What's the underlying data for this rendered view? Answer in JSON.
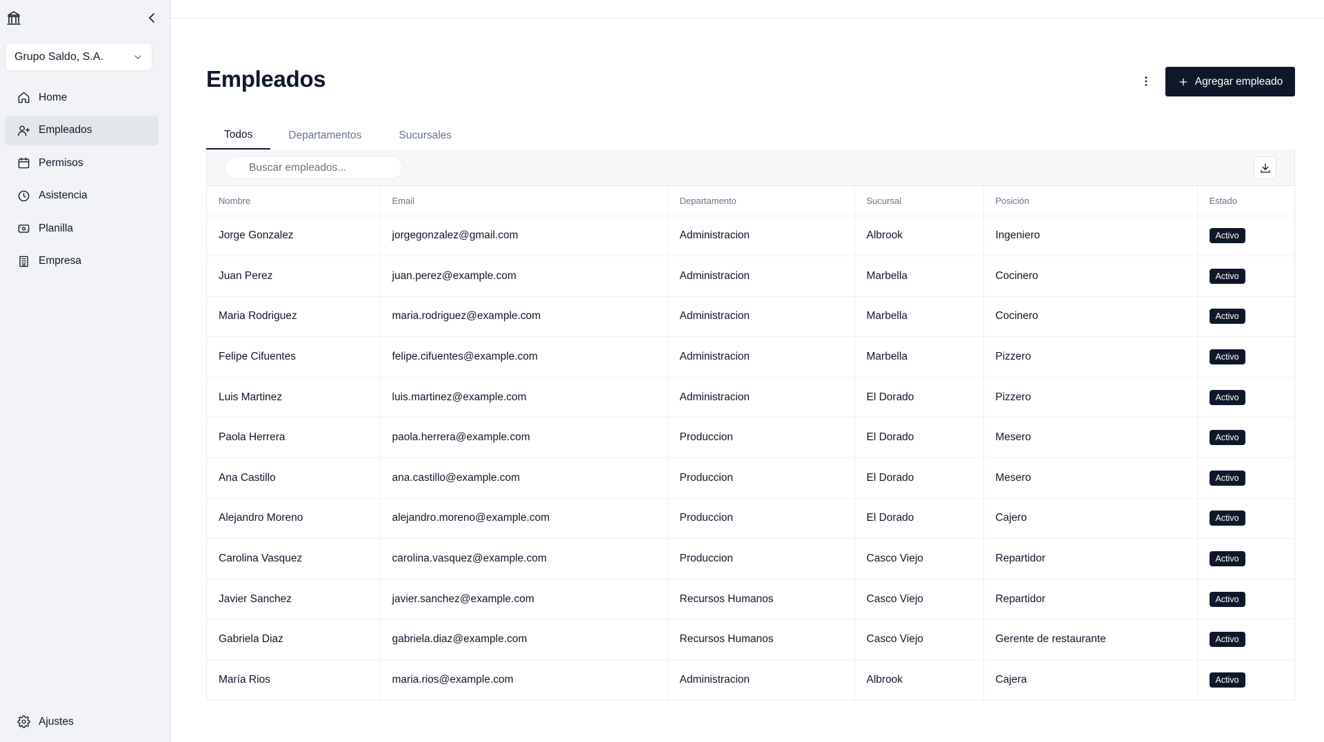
{
  "sidebar": {
    "company": "Grupo Saldo, S.A.",
    "items": [
      {
        "label": "Home",
        "icon": "home-icon"
      },
      {
        "label": "Empleados",
        "icon": "user-plus-icon"
      },
      {
        "label": "Permisos",
        "icon": "calendar-icon"
      },
      {
        "label": "Asistencia",
        "icon": "clock-icon"
      },
      {
        "label": "Planilla",
        "icon": "banknote-icon"
      },
      {
        "label": "Empresa",
        "icon": "building-icon"
      }
    ],
    "active_item": "Empleados",
    "settings_label": "Ajustes"
  },
  "header": {
    "title": "Empleados",
    "add_button_label": "Agregar empleado"
  },
  "tabs": [
    {
      "label": "Todos",
      "active": true
    },
    {
      "label": "Departamentos",
      "active": false
    },
    {
      "label": "Sucursales",
      "active": false
    }
  ],
  "search": {
    "placeholder": "Buscar empleados...",
    "value": ""
  },
  "table": {
    "columns": [
      "Nombre",
      "Email",
      "Departamento",
      "Sucursal",
      "Posición",
      "Estado"
    ],
    "rows": [
      {
        "nombre": "Jorge Gonzalez",
        "email": "jorgegonzalez@gmail.com",
        "departamento": "Administracion",
        "sucursal": "Albrook",
        "posicion": "Ingeniero",
        "estado": "Activo"
      },
      {
        "nombre": "Juan Perez",
        "email": "juan.perez@example.com",
        "departamento": "Administracion",
        "sucursal": "Marbella",
        "posicion": "Cocinero",
        "estado": "Activo"
      },
      {
        "nombre": "Maria Rodriguez",
        "email": "maria.rodriguez@example.com",
        "departamento": "Administracion",
        "sucursal": "Marbella",
        "posicion": "Cocinero",
        "estado": "Activo"
      },
      {
        "nombre": "Felipe Cifuentes",
        "email": "felipe.cifuentes@example.com",
        "departamento": "Administracion",
        "sucursal": "Marbella",
        "posicion": "Pizzero",
        "estado": "Activo"
      },
      {
        "nombre": "Luis Martinez",
        "email": "luis.martinez@example.com",
        "departamento": "Administracion",
        "sucursal": "El Dorado",
        "posicion": "Pizzero",
        "estado": "Activo"
      },
      {
        "nombre": "Paola Herrera",
        "email": "paola.herrera@example.com",
        "departamento": "Produccion",
        "sucursal": "El Dorado",
        "posicion": "Mesero",
        "estado": "Activo"
      },
      {
        "nombre": "Ana Castillo",
        "email": "ana.castillo@example.com",
        "departamento": "Produccion",
        "sucursal": "El Dorado",
        "posicion": "Mesero",
        "estado": "Activo"
      },
      {
        "nombre": "Alejandro Moreno",
        "email": "alejandro.moreno@example.com",
        "departamento": "Produccion",
        "sucursal": "El Dorado",
        "posicion": "Cajero",
        "estado": "Activo"
      },
      {
        "nombre": "Carolina Vasquez",
        "email": "carolina.vasquez@example.com",
        "departamento": "Produccion",
        "sucursal": "Casco Viejo",
        "posicion": "Repartidor",
        "estado": "Activo"
      },
      {
        "nombre": "Javier Sanchez",
        "email": "javier.sanchez@example.com",
        "departamento": "Recursos Humanos",
        "sucursal": "Casco Viejo",
        "posicion": "Repartidor",
        "estado": "Activo"
      },
      {
        "nombre": "Gabriela Diaz",
        "email": "gabriela.diaz@example.com",
        "departamento": "Recursos Humanos",
        "sucursal": "Casco Viejo",
        "posicion": "Gerente de restaurante",
        "estado": "Activo"
      },
      {
        "nombre": "María Rios",
        "email": "maria.rios@example.com",
        "departamento": "Administracion",
        "sucursal": "Albrook",
        "posicion": "Cajera",
        "estado": "Activo"
      }
    ]
  },
  "colors": {
    "primary": "#0f172a",
    "sidebar_bg": "#f1f3f6",
    "muted_text": "#64748b"
  }
}
